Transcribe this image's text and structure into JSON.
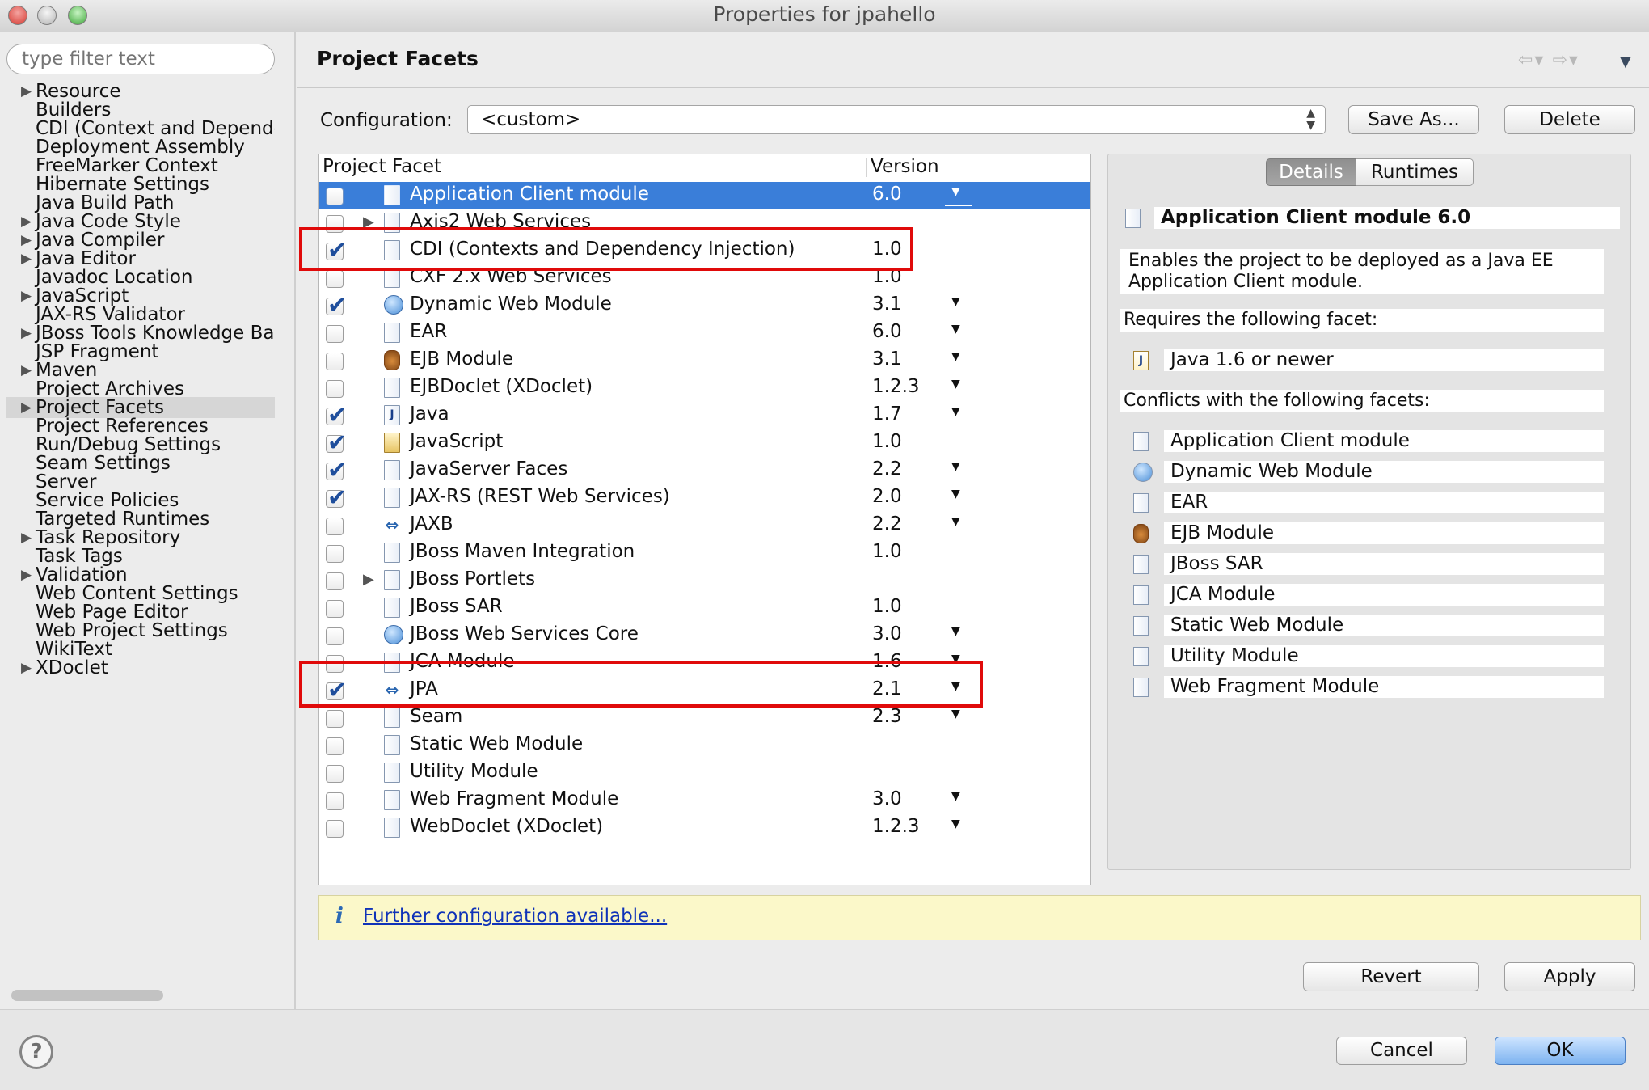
{
  "window": {
    "title": "Properties for jpahello"
  },
  "filter": {
    "placeholder": "type filter text"
  },
  "nav": {
    "items": [
      {
        "label": "Resource",
        "expandable": true
      },
      {
        "label": "Builders",
        "expandable": false
      },
      {
        "label": "CDI (Context and Dependen",
        "expandable": false
      },
      {
        "label": "Deployment Assembly",
        "expandable": false
      },
      {
        "label": "FreeMarker Context",
        "expandable": false
      },
      {
        "label": "Hibernate Settings",
        "expandable": false
      },
      {
        "label": "Java Build Path",
        "expandable": false
      },
      {
        "label": "Java Code Style",
        "expandable": true
      },
      {
        "label": "Java Compiler",
        "expandable": true
      },
      {
        "label": "Java Editor",
        "expandable": true
      },
      {
        "label": "Javadoc Location",
        "expandable": false
      },
      {
        "label": "JavaScript",
        "expandable": true
      },
      {
        "label": "JAX-RS Validator",
        "expandable": false
      },
      {
        "label": "JBoss Tools Knowledge Base",
        "expandable": true
      },
      {
        "label": "JSP Fragment",
        "expandable": false
      },
      {
        "label": "Maven",
        "expandable": true
      },
      {
        "label": "Project Archives",
        "expandable": false
      },
      {
        "label": "Project Facets",
        "expandable": true,
        "selected": true
      },
      {
        "label": "Project References",
        "expandable": false
      },
      {
        "label": "Run/Debug Settings",
        "expandable": false
      },
      {
        "label": "Seam Settings",
        "expandable": false
      },
      {
        "label": "Server",
        "expandable": false
      },
      {
        "label": "Service Policies",
        "expandable": false
      },
      {
        "label": "Targeted Runtimes",
        "expandable": false
      },
      {
        "label": "Task Repository",
        "expandable": true
      },
      {
        "label": "Task Tags",
        "expandable": false
      },
      {
        "label": "Validation",
        "expandable": true
      },
      {
        "label": "Web Content Settings",
        "expandable": false
      },
      {
        "label": "Web Page Editor",
        "expandable": false
      },
      {
        "label": "Web Project Settings",
        "expandable": false
      },
      {
        "label": "WikiText",
        "expandable": false
      },
      {
        "label": "XDoclet",
        "expandable": true
      }
    ]
  },
  "page": {
    "title": "Project Facets"
  },
  "config": {
    "label": "Configuration:",
    "value": "<custom>",
    "save_as": "Save As...",
    "delete": "Delete"
  },
  "table": {
    "col_facet": "Project Facet",
    "col_version": "Version",
    "rows": [
      {
        "name": "Application Client module",
        "version": "6.0",
        "checked": false,
        "dropdown": true,
        "icon": "page-icon",
        "selected": true
      },
      {
        "name": "Axis2 Web Services",
        "version": "",
        "checked": false,
        "dropdown": false,
        "icon": "page-icon",
        "expander": true
      },
      {
        "name": "CDI (Contexts and Dependency Injection)",
        "version": "1.0",
        "checked": true,
        "dropdown": false,
        "icon": "page-icon"
      },
      {
        "name": "CXF 2.x Web Services",
        "version": "1.0",
        "checked": false,
        "dropdown": false,
        "icon": "page-icon"
      },
      {
        "name": "Dynamic Web Module",
        "version": "3.1",
        "checked": true,
        "dropdown": true,
        "icon": "globe-icon"
      },
      {
        "name": "EAR",
        "version": "6.0",
        "checked": false,
        "dropdown": true,
        "icon": "page-icon"
      },
      {
        "name": "EJB Module",
        "version": "3.1",
        "checked": false,
        "dropdown": true,
        "icon": "bean-icon"
      },
      {
        "name": "EJBDoclet (XDoclet)",
        "version": "1.2.3",
        "checked": false,
        "dropdown": true,
        "icon": "page-icon"
      },
      {
        "name": "Java",
        "version": "1.7",
        "checked": true,
        "dropdown": true,
        "icon": "java-icon"
      },
      {
        "name": "JavaScript",
        "version": "1.0",
        "checked": true,
        "dropdown": false,
        "icon": "lock-icon"
      },
      {
        "name": "JavaServer Faces",
        "version": "2.2",
        "checked": true,
        "dropdown": true,
        "icon": "page-icon"
      },
      {
        "name": "JAX-RS (REST Web Services)",
        "version": "2.0",
        "checked": true,
        "dropdown": true,
        "icon": "page-icon"
      },
      {
        "name": "JAXB",
        "version": "2.2",
        "checked": false,
        "dropdown": true,
        "icon": "arrows-icon"
      },
      {
        "name": "JBoss Maven Integration",
        "version": "1.0",
        "checked": false,
        "dropdown": false,
        "icon": "page-icon"
      },
      {
        "name": "JBoss Portlets",
        "version": "",
        "checked": false,
        "dropdown": false,
        "icon": "page-icon",
        "expander": true
      },
      {
        "name": "JBoss SAR",
        "version": "1.0",
        "checked": false,
        "dropdown": false,
        "icon": "page-icon"
      },
      {
        "name": "JBoss Web Services Core",
        "version": "3.0",
        "checked": false,
        "dropdown": true,
        "icon": "globe-icon"
      },
      {
        "name": "JCA Module",
        "version": "1.6",
        "checked": false,
        "dropdown": true,
        "icon": "page-icon"
      },
      {
        "name": "JPA",
        "version": "2.1",
        "checked": true,
        "dropdown": true,
        "icon": "arrows-icon"
      },
      {
        "name": "Seam",
        "version": "2.3",
        "checked": false,
        "dropdown": true,
        "icon": "page-icon"
      },
      {
        "name": "Static Web Module",
        "version": "",
        "checked": false,
        "dropdown": false,
        "icon": "page-icon"
      },
      {
        "name": "Utility Module",
        "version": "",
        "checked": false,
        "dropdown": false,
        "icon": "page-icon"
      },
      {
        "name": "Web Fragment Module",
        "version": "3.0",
        "checked": false,
        "dropdown": true,
        "icon": "page-icon"
      },
      {
        "name": "WebDoclet (XDoclet)",
        "version": "1.2.3",
        "checked": false,
        "dropdown": true,
        "icon": "page-icon"
      }
    ]
  },
  "details": {
    "tabs": {
      "details": "Details",
      "runtimes": "Runtimes"
    },
    "title": "Application Client module 6.0",
    "description": "Enables the project to be deployed as a Java EE Application Client module.",
    "requires_label": "Requires the following facet:",
    "requires": [
      {
        "label": "Java 1.6 or newer",
        "icon": "java-icon"
      }
    ],
    "conflicts_label": "Conflicts with the following facets:",
    "conflicts": [
      {
        "label": "Application Client module",
        "icon": "page-icon"
      },
      {
        "label": "Dynamic Web Module",
        "icon": "globe-icon"
      },
      {
        "label": "EAR",
        "icon": "page-icon"
      },
      {
        "label": "EJB Module",
        "icon": "bean-icon"
      },
      {
        "label": "JBoss SAR",
        "icon": "page-icon"
      },
      {
        "label": "JCA Module",
        "icon": "page-icon"
      },
      {
        "label": "Static Web Module",
        "icon": "page-icon"
      },
      {
        "label": "Utility Module",
        "icon": "page-icon"
      },
      {
        "label": "Web Fragment Module",
        "icon": "page-icon"
      }
    ]
  },
  "info": {
    "icon": "i",
    "link": "Further configuration available..."
  },
  "buttons": {
    "revert": "Revert",
    "apply": "Apply",
    "cancel": "Cancel",
    "ok": "OK",
    "help": "?"
  },
  "colors": {
    "selection": "#3a7ed9",
    "highlight_box": "#e00a0a",
    "info_bg": "#fbf8c9"
  }
}
